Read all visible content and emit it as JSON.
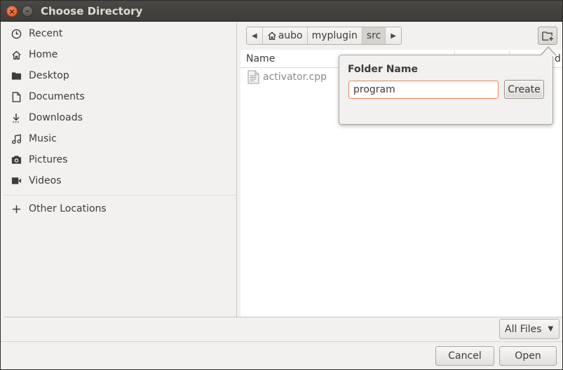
{
  "window": {
    "title": "Choose Directory"
  },
  "sidebar": {
    "items": [
      {
        "label": "Recent",
        "icon": "clock-icon"
      },
      {
        "label": "Home",
        "icon": "home-icon"
      },
      {
        "label": "Desktop",
        "icon": "folder-icon"
      },
      {
        "label": "Documents",
        "icon": "document-icon"
      },
      {
        "label": "Downloads",
        "icon": "download-icon"
      },
      {
        "label": "Music",
        "icon": "music-icon"
      },
      {
        "label": "Pictures",
        "icon": "camera-icon"
      },
      {
        "label": "Videos",
        "icon": "video-icon"
      },
      {
        "label": "Other Locations",
        "icon": "plus-icon"
      }
    ]
  },
  "pathbar": {
    "segments": [
      "aubo",
      "myplugin",
      "src"
    ],
    "active": "src"
  },
  "filelist": {
    "columns": {
      "name": "Name",
      "date_partial": "d"
    },
    "files": [
      {
        "name": "activator.cpp",
        "icon": "text-file-icon"
      }
    ]
  },
  "popover": {
    "title": "Folder Name",
    "input_value": "program",
    "create_label": "Create"
  },
  "filter": {
    "selected": "All Files"
  },
  "buttons": {
    "cancel": "Cancel",
    "open": "Open"
  }
}
